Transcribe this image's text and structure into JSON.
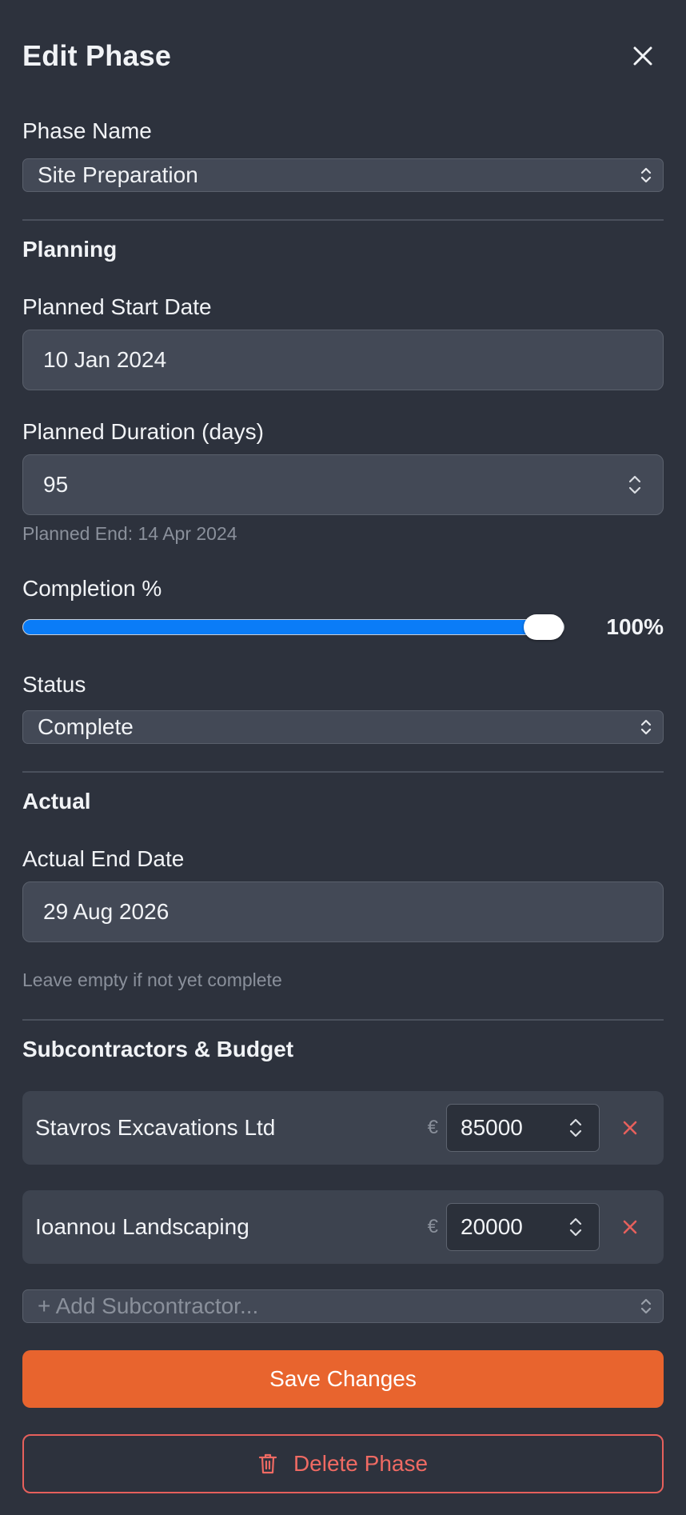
{
  "header": {
    "title": "Edit Phase"
  },
  "phase_name": {
    "label": "Phase Name",
    "value": "Site Preparation"
  },
  "planning": {
    "section_title": "Planning",
    "start_date_label": "Planned Start Date",
    "start_date_value": "10 Jan 2024",
    "duration_label": "Planned Duration (days)",
    "duration_value": "95",
    "planned_end": "Planned End: 14 Apr 2024",
    "completion_label": "Completion %",
    "completion_value": 100,
    "completion_text": "100%",
    "status_label": "Status",
    "status_value": "Complete"
  },
  "actual": {
    "section_title": "Actual",
    "end_date_label": "Actual End Date",
    "end_date_value": "29 Aug 2026",
    "hint": "Leave empty if not yet complete"
  },
  "subcontractors": {
    "section_title": "Subcontractors & Budget",
    "currency_symbol": "€",
    "items": [
      {
        "name": "Stavros Excavations Ltd",
        "amount": "85000"
      },
      {
        "name": "Ioannou Landscaping",
        "amount": "20000"
      }
    ],
    "add_placeholder": "+ Add Subcontractor..."
  },
  "actions": {
    "save_label": "Save Changes",
    "delete_label": "Delete Phase"
  },
  "colors": {
    "background": "#2d323d",
    "accent": "#e8642e",
    "danger": "#e6605c",
    "slider": "#0a7cf7"
  }
}
